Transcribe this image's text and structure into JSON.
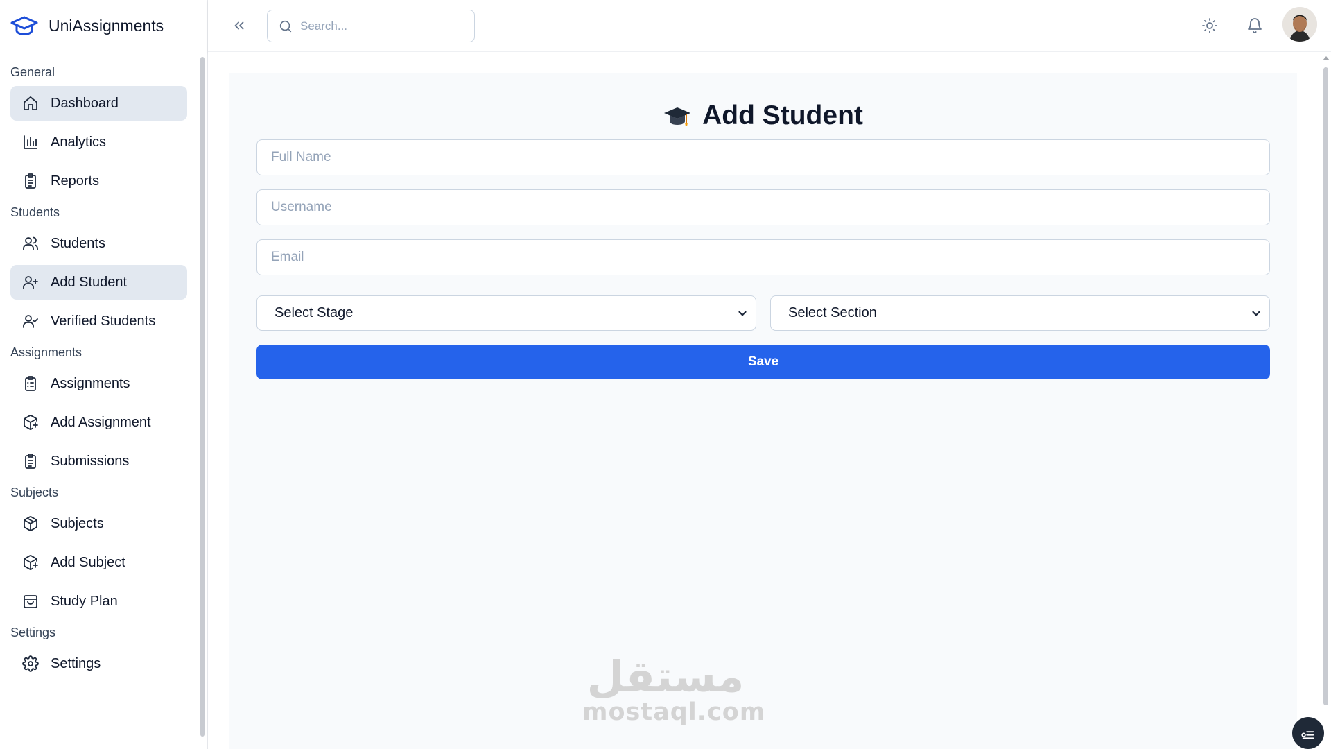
{
  "app": {
    "name": "UniAssignments"
  },
  "sidebar": {
    "groups": [
      {
        "title": "General",
        "items": [
          {
            "label": "Dashboard",
            "icon": "home-icon",
            "active": true
          },
          {
            "label": "Analytics",
            "icon": "bar-chart-icon"
          },
          {
            "label": "Reports",
            "icon": "clipboard-icon"
          }
        ]
      },
      {
        "title": "Students",
        "items": [
          {
            "label": "Students",
            "icon": "users-icon"
          },
          {
            "label": "Add Student",
            "icon": "user-plus-icon",
            "active": true
          },
          {
            "label": "Verified Students",
            "icon": "user-check-icon"
          }
        ]
      },
      {
        "title": "Assignments",
        "items": [
          {
            "label": "Assignments",
            "icon": "clipboard-list-icon"
          },
          {
            "label": "Add Assignment",
            "icon": "package-plus-icon"
          },
          {
            "label": "Submissions",
            "icon": "clipboard-check-icon"
          }
        ]
      },
      {
        "title": "Subjects",
        "items": [
          {
            "label": "Subjects",
            "icon": "box-icon"
          },
          {
            "label": "Add Subject",
            "icon": "package-plus-icon"
          },
          {
            "label": "Study Plan",
            "icon": "shopping-bag-icon"
          }
        ]
      },
      {
        "title": "Settings",
        "items": [
          {
            "label": "Settings",
            "icon": "gear-icon"
          }
        ]
      }
    ]
  },
  "header": {
    "search": {
      "placeholder": "Search..."
    }
  },
  "form": {
    "title": "Add Student",
    "full_name": {
      "placeholder": "Full Name"
    },
    "username": {
      "placeholder": "Username"
    },
    "email": {
      "placeholder": "Email"
    },
    "stage": {
      "selected": "Select Stage"
    },
    "section": {
      "selected": "Select Section"
    },
    "save_label": "Save"
  },
  "watermark": {
    "arabic": "مستقل",
    "latin": "mostaql.com"
  },
  "colors": {
    "primary": "#2563eb",
    "active_bg": "#e2e8f0",
    "text": "#0f172a",
    "muted": "#94a3b8"
  }
}
